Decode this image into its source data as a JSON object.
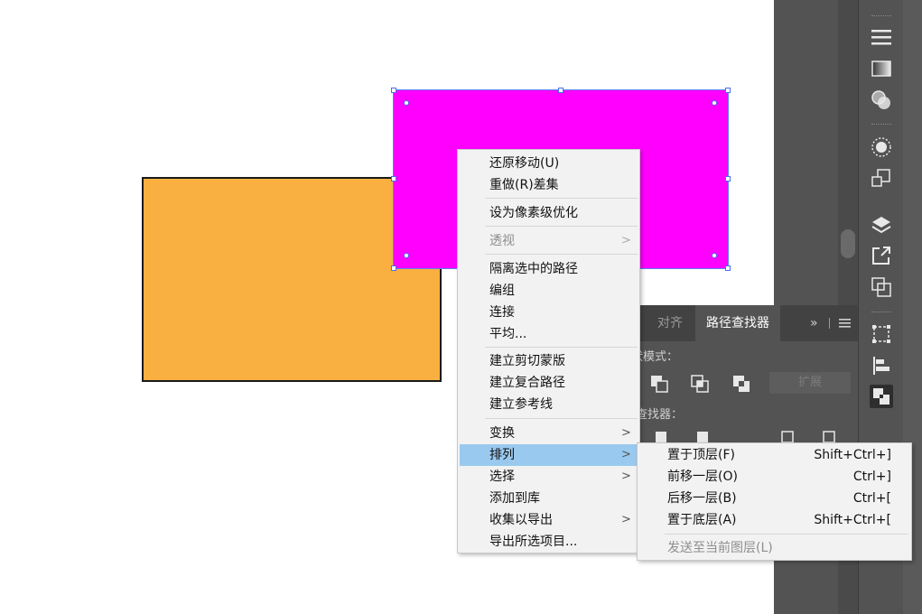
{
  "context_menu": {
    "items": [
      {
        "label": "还原移动(U)"
      },
      {
        "label": "重做(R)差集"
      },
      {
        "label": "设为像素级优化"
      },
      {
        "label": "透视",
        "arrow": ">"
      },
      {
        "label": "隔离选中的路径"
      },
      {
        "label": "编组"
      },
      {
        "label": "连接"
      },
      {
        "label": "平均..."
      },
      {
        "label": "建立剪切蒙版"
      },
      {
        "label": "建立复合路径"
      },
      {
        "label": "建立参考线"
      },
      {
        "label": "变换",
        "arrow": ">"
      },
      {
        "label": "排列",
        "arrow": ">"
      },
      {
        "label": "选择",
        "arrow": ">"
      },
      {
        "label": "添加到库"
      },
      {
        "label": "收集以导出",
        "arrow": ">"
      },
      {
        "label": "导出所选项目..."
      }
    ]
  },
  "arrange_submenu": {
    "items": [
      {
        "label": "置于顶层(F)",
        "shortcut": "Shift+Ctrl+]"
      },
      {
        "label": "前移一层(O)",
        "shortcut": "Ctrl+]"
      },
      {
        "label": "后移一层(B)",
        "shortcut": "Ctrl+["
      },
      {
        "label": "置于底层(A)",
        "shortcut": "Shift+Ctrl+["
      },
      {
        "label": "发送至当前图层(L)"
      }
    ]
  },
  "pathfinder_panel": {
    "tab_align": "对齐",
    "tab_pathfinder": "路径查找器",
    "collapse": "»",
    "shape_modes_label": "形状模式：",
    "pathfinders_label": "路径查找器：",
    "expand_button": "扩展"
  },
  "colors": {
    "orange_shape": "#f9b040",
    "magenta_shape": "#ff00ff",
    "selection": "#4a6cf0",
    "menu_highlight": "#99c9ef",
    "panel_bg": "#535353"
  }
}
